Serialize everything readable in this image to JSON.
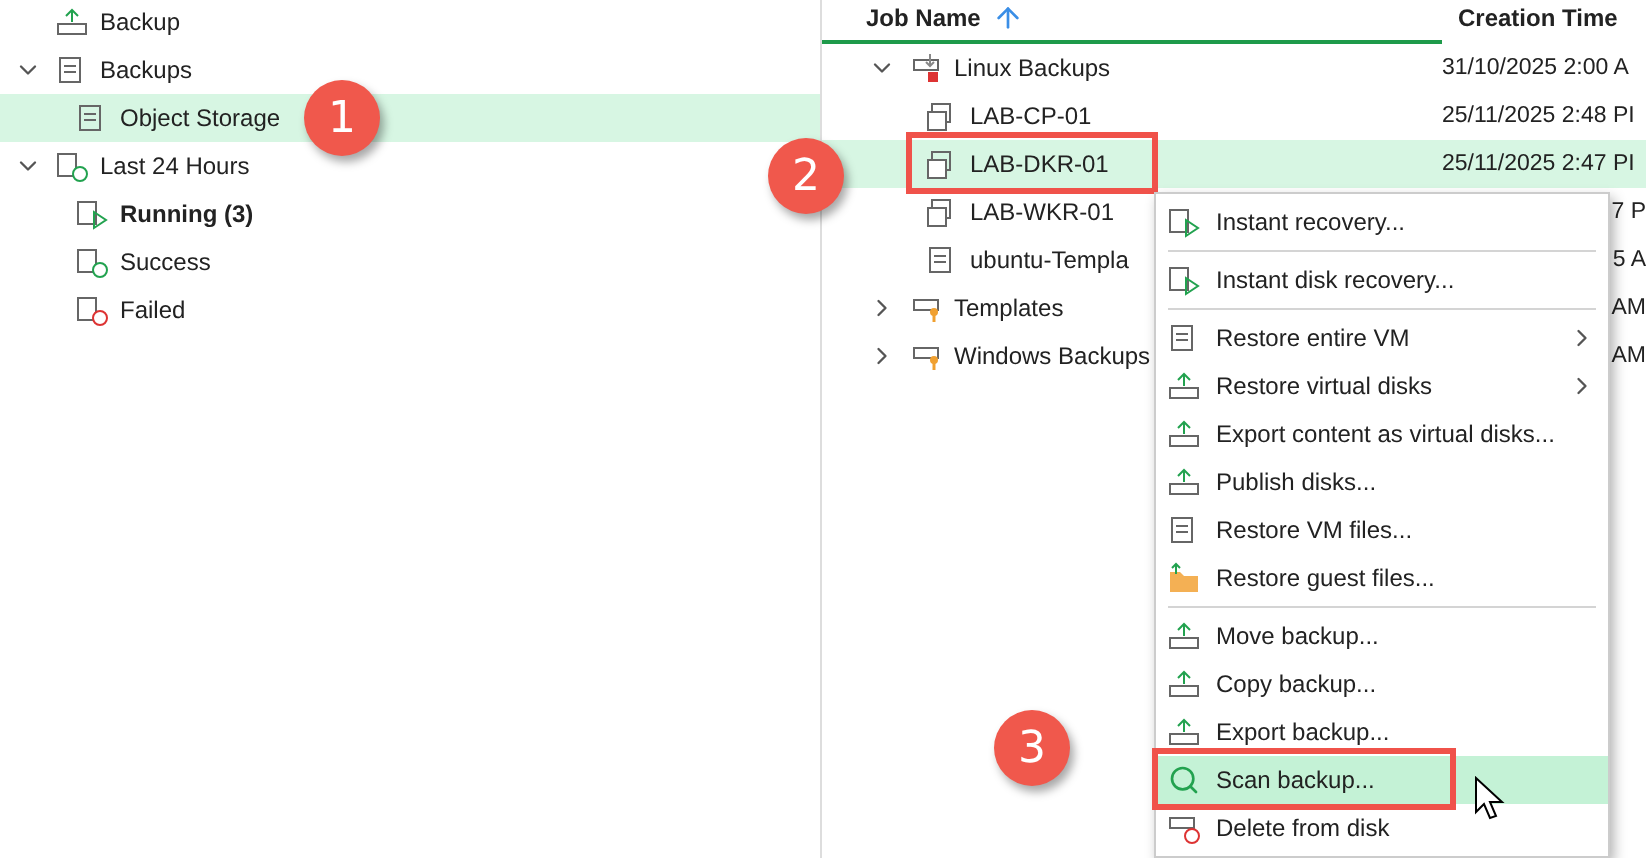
{
  "sidebar": {
    "items": [
      {
        "label": "Backup",
        "bold": false,
        "selected": false
      },
      {
        "label": "Backups",
        "expanded": true,
        "bold": false,
        "selected": false,
        "children": [
          {
            "label": "Object Storage",
            "bold": false,
            "selected": true
          }
        ]
      },
      {
        "label": "Last 24 Hours",
        "expanded": true,
        "bold": false,
        "selected": false,
        "children": [
          {
            "label": "Running (3)",
            "bold": true,
            "selected": false
          },
          {
            "label": "Success",
            "bold": false,
            "selected": false
          },
          {
            "label": "Failed",
            "bold": false,
            "selected": false
          }
        ]
      }
    ]
  },
  "table": {
    "columns": [
      {
        "label": "Job Name",
        "sorted": true
      },
      {
        "label": "Creation Time",
        "sorted": false
      }
    ],
    "rows": [
      {
        "name": "Linux Backups",
        "time": "31/10/2025 2:00 A",
        "expanded": true,
        "selected": false,
        "children": [
          {
            "name": "LAB-CP-01",
            "time": "25/11/2025 2:48 PI",
            "selected": false
          },
          {
            "name": "LAB-DKR-01",
            "time": "25/11/2025 2:47 PI",
            "selected": true,
            "highlighted": true
          },
          {
            "name": "LAB-WKR-01",
            "time": "7 P",
            "selected": false
          },
          {
            "name": "ubuntu-Templa",
            "time": "5 A",
            "selected": false
          }
        ]
      },
      {
        "name": "Templates",
        "time": "AM",
        "expanded": false,
        "selected": false
      },
      {
        "name": "Windows Backups",
        "time": "AM",
        "expanded": false,
        "selected": false
      }
    ]
  },
  "context_menu": {
    "groups": [
      [
        {
          "label": "Instant recovery...",
          "selected": false
        }
      ],
      [
        {
          "label": "Instant disk recovery...",
          "selected": false
        }
      ],
      [
        {
          "label": "Restore entire VM",
          "submenu": true,
          "selected": false
        },
        {
          "label": "Restore virtual disks",
          "submenu": true,
          "selected": false
        },
        {
          "label": "Export content as virtual disks...",
          "selected": false
        },
        {
          "label": "Publish disks...",
          "selected": false
        },
        {
          "label": "Restore VM files...",
          "selected": false
        },
        {
          "label": "Restore guest files...",
          "selected": false
        }
      ],
      [
        {
          "label": "Move backup...",
          "selected": false
        },
        {
          "label": "Copy backup...",
          "selected": false
        },
        {
          "label": "Export backup...",
          "selected": false
        },
        {
          "label": "Scan backup...",
          "selected": true,
          "highlighted": true
        },
        {
          "label": "Delete from disk",
          "selected": false
        }
      ]
    ]
  },
  "callouts": [
    {
      "number": "1"
    },
    {
      "number": "2"
    },
    {
      "number": "3"
    }
  ]
}
